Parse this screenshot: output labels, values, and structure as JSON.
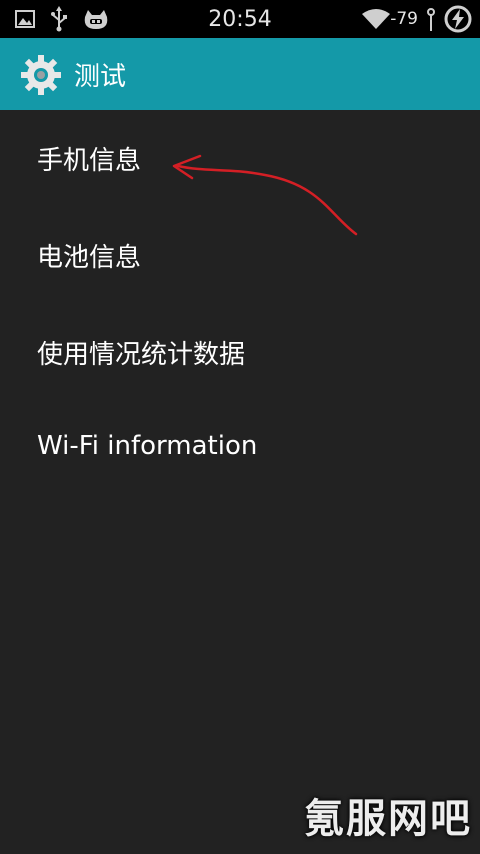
{
  "status_bar": {
    "time": "20:54",
    "signal_text": "-79",
    "icons": [
      "image-icon",
      "usb-icon",
      "cyanogenmod-icon",
      "wifi-icon",
      "battery-charging-icon"
    ]
  },
  "action_bar": {
    "title": "测试",
    "icon": "gear-icon"
  },
  "list": {
    "items": [
      {
        "label": "手机信息"
      },
      {
        "label": "电池信息"
      },
      {
        "label": "使用情况统计数据"
      },
      {
        "label": "Wi-Fi information"
      }
    ]
  },
  "annotation": {
    "color": "#d41f25"
  },
  "watermark": {
    "text": "氪服网吧"
  },
  "colors": {
    "action_bar": "#1499a8",
    "background": "#222222",
    "status_bar": "#000000"
  }
}
